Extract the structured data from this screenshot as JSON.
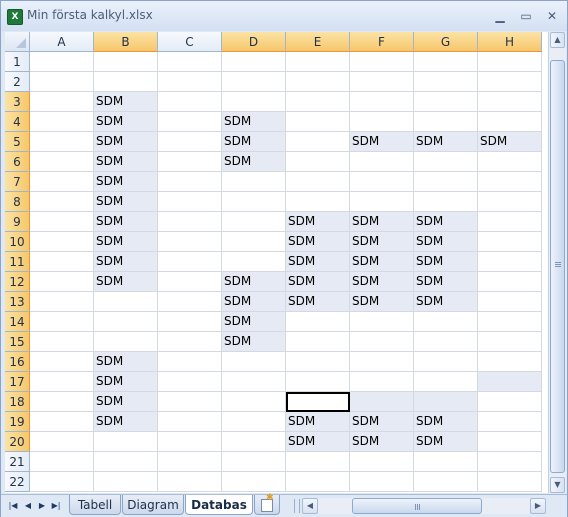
{
  "window": {
    "title": "Min första kalkyl.xlsx",
    "app_icon": "excel-icon",
    "buttons": {
      "minimize": "minimize-icon",
      "maximize": "maximize-icon",
      "close": "close-icon"
    }
  },
  "sheet": {
    "columns": [
      "A",
      "B",
      "C",
      "D",
      "E",
      "F",
      "G",
      "H"
    ],
    "selected_columns": [
      "B",
      "D",
      "E",
      "F",
      "G",
      "H"
    ],
    "rows": [
      "1",
      "2",
      "3",
      "4",
      "5",
      "6",
      "7",
      "8",
      "9",
      "10",
      "11",
      "12",
      "13",
      "14",
      "15",
      "16",
      "17",
      "18",
      "19",
      "20",
      "21",
      "22"
    ],
    "selected_rows": [
      "3",
      "4",
      "5",
      "6",
      "7",
      "8",
      "9",
      "10",
      "11",
      "12",
      "13",
      "14",
      "15",
      "16",
      "17",
      "18",
      "19",
      "20"
    ],
    "active_cell": "E18",
    "cells": {
      "B3": "SDM",
      "B4": "SDM",
      "B5": "SDM",
      "B6": "SDM",
      "B7": "SDM",
      "B8": "SDM",
      "B9": "SDM",
      "B10": "SDM",
      "B11": "SDM",
      "B12": "SDM",
      "B16": "SDM",
      "B17": "SDM",
      "B18": "SDM",
      "B19": "SDM",
      "D4": "SDM",
      "D5": "SDM",
      "D6": "SDM",
      "D12": "SDM",
      "D13": "SDM",
      "D14": "SDM",
      "D15": "SDM",
      "F5": "SDM",
      "G5": "SDM",
      "H5": "SDM",
      "E9": "SDM",
      "F9": "SDM",
      "G9": "SDM",
      "E10": "SDM",
      "F10": "SDM",
      "G10": "SDM",
      "E11": "SDM",
      "F11": "SDM",
      "G11": "SDM",
      "E12": "SDM",
      "F12": "SDM",
      "G12": "SDM",
      "E13": "SDM",
      "F13": "SDM",
      "G13": "SDM",
      "E19": "SDM",
      "F19": "SDM",
      "G19": "SDM",
      "E20": "SDM",
      "F20": "SDM",
      "G20": "SDM"
    },
    "selected_ranges": [
      [
        "B",
        3,
        12
      ],
      [
        "B",
        16,
        19
      ],
      [
        "D",
        4,
        6
      ],
      [
        "D",
        12,
        15
      ],
      [
        "F",
        5,
        5
      ],
      [
        "G",
        5,
        5
      ],
      [
        "H",
        5,
        5
      ],
      [
        "E",
        9,
        13
      ],
      [
        "F",
        9,
        13
      ],
      [
        "G",
        9,
        13
      ],
      [
        "E",
        18,
        20
      ],
      [
        "F",
        18,
        20
      ],
      [
        "G",
        18,
        20
      ],
      [
        "H",
        17,
        17
      ]
    ]
  },
  "sheet_tabs": {
    "nav_icons": [
      "first-sheet-icon",
      "prev-sheet-icon",
      "next-sheet-icon",
      "last-sheet-icon"
    ],
    "tabs": [
      "Tabell",
      "Diagram",
      "Databas"
    ],
    "active_tab": "Databas",
    "new_sheet_icon": "insert-worksheet-icon"
  },
  "colors": {
    "selection_fill": "#e6eaf4",
    "header_selected": "#f6c76b",
    "gridline": "#d4d8e0"
  }
}
